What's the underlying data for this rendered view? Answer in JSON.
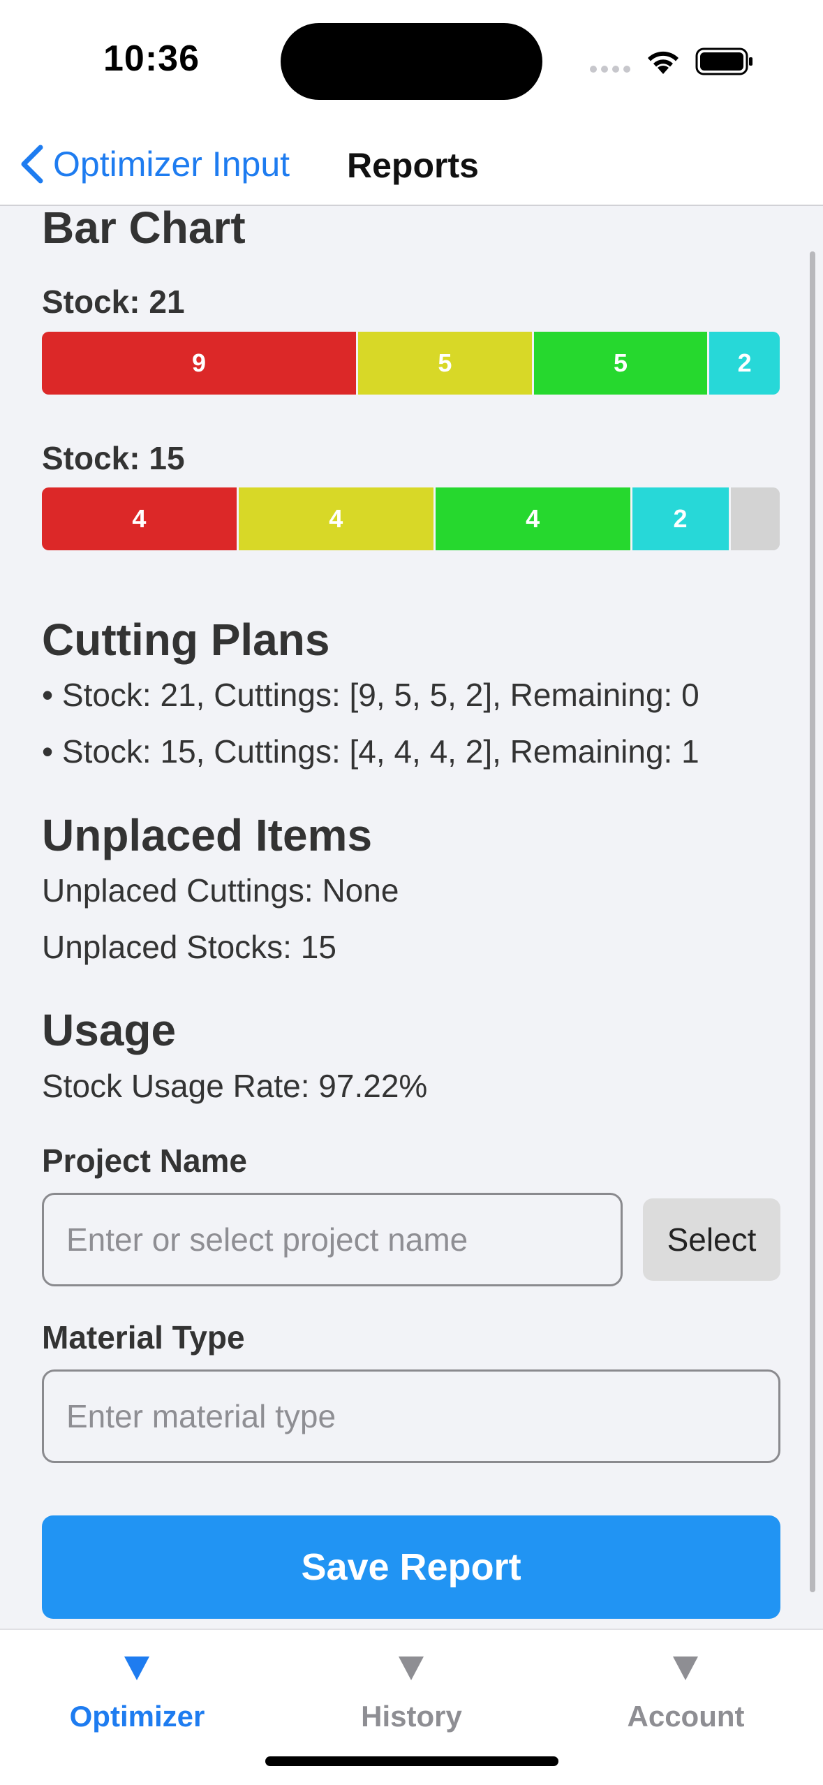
{
  "status": {
    "time": "10:36"
  },
  "nav": {
    "back_label": "Optimizer Input",
    "title": "Reports"
  },
  "bar_chart": {
    "title": "Bar Chart",
    "stocks": [
      {
        "label": "Stock: 21",
        "total": 21,
        "segments": [
          {
            "value": 9,
            "label": "9",
            "color": "#dc2828"
          },
          {
            "value": 5,
            "label": "5",
            "color": "#d8d827"
          },
          {
            "value": 5,
            "label": "5",
            "color": "#26d82e"
          },
          {
            "value": 2,
            "label": "2",
            "color": "#27d8d8"
          }
        ],
        "remaining": 0
      },
      {
        "label": "Stock: 15",
        "total": 15,
        "segments": [
          {
            "value": 4,
            "label": "4",
            "color": "#dc2828"
          },
          {
            "value": 4,
            "label": "4",
            "color": "#d8d827"
          },
          {
            "value": 4,
            "label": "4",
            "color": "#26d82e"
          },
          {
            "value": 2,
            "label": "2",
            "color": "#27d8d8"
          }
        ],
        "remaining": 1,
        "remaining_color": "#d3d3d3"
      }
    ]
  },
  "cutting_plans": {
    "title": "Cutting Plans",
    "items": [
      "• Stock: 21, Cuttings: [9, 5, 5, 2], Remaining: 0",
      "• Stock: 15, Cuttings: [4, 4, 4, 2], Remaining: 1"
    ]
  },
  "unplaced": {
    "title": "Unplaced Items",
    "cuttings": "Unplaced Cuttings: None",
    "stocks": "Unplaced Stocks: 15"
  },
  "usage": {
    "title": "Usage",
    "rate": "Stock Usage Rate: 97.22%"
  },
  "form": {
    "project_label": "Project Name",
    "project_placeholder": "Enter or select project name",
    "select_label": "Select",
    "material_label": "Material Type",
    "material_placeholder": "Enter material type",
    "save_label": "Save Report"
  },
  "tabs": [
    {
      "label": "Optimizer",
      "active": true
    },
    {
      "label": "History",
      "active": false
    },
    {
      "label": "Account",
      "active": false
    }
  ],
  "colors": {
    "accent": "#1e7cf0",
    "button": "#2194f3",
    "tab_inactive": "#8e8e93"
  }
}
